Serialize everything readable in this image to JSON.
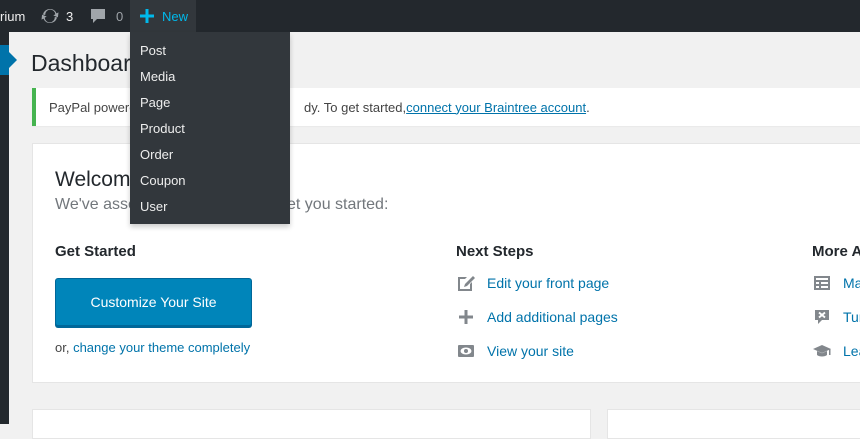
{
  "adminbar": {
    "site_name": "rium",
    "updates_count": "3",
    "comments_count": "0",
    "new_label": "New"
  },
  "new_menu": {
    "items": [
      "Post",
      "Media",
      "Page",
      "Product",
      "Order",
      "Coupon",
      "User"
    ]
  },
  "page": {
    "title": "Dashboard"
  },
  "notice": {
    "text_lead": "PayPal powered",
    "text_mid": "dy. To get started, ",
    "link": "connect your Braintree account",
    "text_end": "."
  },
  "welcome": {
    "title": "Welcome",
    "about_lead": "We've asse",
    "about_tail": "et you started:",
    "get_started": {
      "title": "Get Started",
      "button": "Customize Your Site",
      "alt_prefix": "or, ",
      "alt_link": "change your theme completely"
    },
    "next_steps": {
      "title": "Next Steps",
      "items": [
        {
          "label": "Edit your front page",
          "icon": "edit-page-icon"
        },
        {
          "label": "Add additional pages",
          "icon": "plus-icon"
        },
        {
          "label": "View your site",
          "icon": "visibility-icon"
        }
      ]
    },
    "more_actions": {
      "title": "More A",
      "items": [
        {
          "label": "Ma",
          "icon": "widgets-menus-icon"
        },
        {
          "label": "Tur",
          "icon": "comments-off-icon"
        },
        {
          "label": "Lea",
          "icon": "learn-more-icon"
        }
      ]
    }
  },
  "colors": {
    "adminbar_bg": "#23282d",
    "accent": "#0073aa",
    "button_primary": "#0085ba",
    "notice_success": "#46b450",
    "new_highlight": "#00b9eb"
  }
}
